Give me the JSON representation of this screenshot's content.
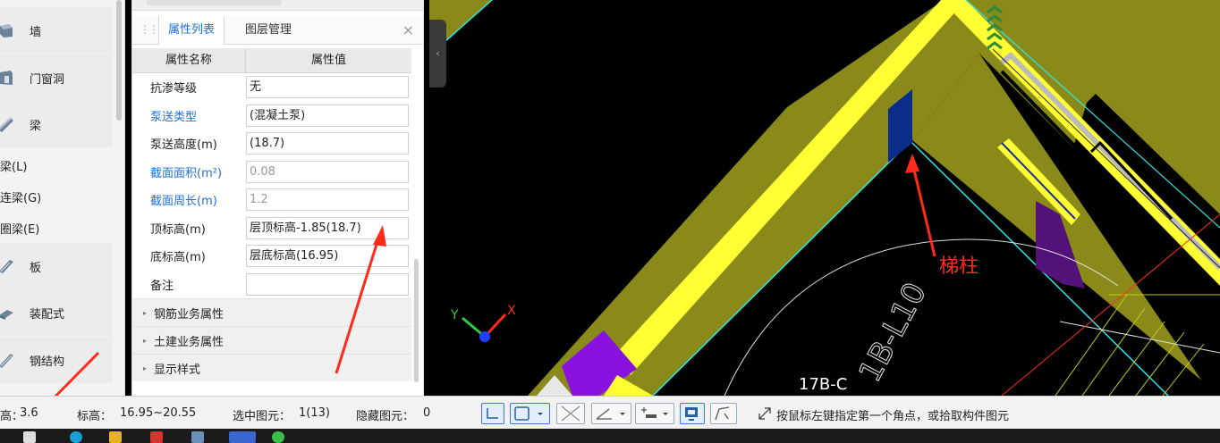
{
  "tree": {
    "categories": [
      {
        "label": "墙",
        "icon": "wall-icon"
      },
      {
        "label": "门窗洞",
        "icon": "door-window-icon"
      },
      {
        "label": "梁",
        "icon": "beam-icon"
      },
      {
        "label": "板",
        "icon": "slab-icon"
      },
      {
        "label": "装配式",
        "icon": "prefab-icon"
      },
      {
        "label": "钢结构",
        "icon": "steel-structure-icon"
      }
    ],
    "beam_subitems": [
      "梁(L)",
      "连梁(G)",
      "圈梁(E)"
    ]
  },
  "panel": {
    "tabs": [
      {
        "label": "属性列表",
        "active": true
      },
      {
        "label": "图层管理",
        "active": false
      }
    ],
    "close": "×",
    "columns": {
      "name": "属性名称",
      "value": "属性值"
    },
    "rows": [
      {
        "name": "抗渗等级",
        "value": "无",
        "name_blue": false,
        "value_grey": false
      },
      {
        "name": "泵送类型",
        "value": "(混凝土泵)",
        "name_blue": true,
        "value_grey": false
      },
      {
        "name": "泵送高度(m)",
        "value": "(18.7)",
        "name_blue": false,
        "value_grey": false
      },
      {
        "name": "截面面积(m²)",
        "value": "0.08",
        "name_blue": true,
        "value_grey": true
      },
      {
        "name": "截面周长(m)",
        "value": "1.2",
        "name_blue": true,
        "value_grey": true
      },
      {
        "name": "顶标高(m)",
        "value": "层顶标高-1.85(18.7)",
        "name_blue": false,
        "value_grey": false
      },
      {
        "name": "底标高(m)",
        "value": "层底标高(16.95)",
        "name_blue": false,
        "value_grey": false
      },
      {
        "name": "备注",
        "value": "",
        "name_blue": false,
        "value_grey": false
      }
    ],
    "groups": [
      "钢筋业务属性",
      "土建业务属性",
      "显示样式"
    ]
  },
  "viewport": {
    "annotation": "梯柱",
    "axis_label": "17B-C",
    "rotated_label": "1B-L10",
    "axis_x": "X",
    "axis_y": "Y"
  },
  "status": {
    "floor_height_label": "高：",
    "floor_height_value": "3.6",
    "elevation_label": "标高：",
    "elevation_value": "16.95~20.55",
    "selected_label": "选中图元：",
    "selected_value": "1(13)",
    "hidden_label": "隐藏图元：",
    "hidden_value": "0",
    "hint": "按鼠标左键指定第一个角点，或拾取构件图元"
  },
  "colors": {
    "wall_yellow": "#ffff33",
    "wall_olive": "#8a8a1a",
    "accent_blue": "#1e6fd9",
    "annotation_red": "#ff2a1a",
    "column_blue": "#0a2d8a",
    "column_purple": "#7a0fd8"
  }
}
